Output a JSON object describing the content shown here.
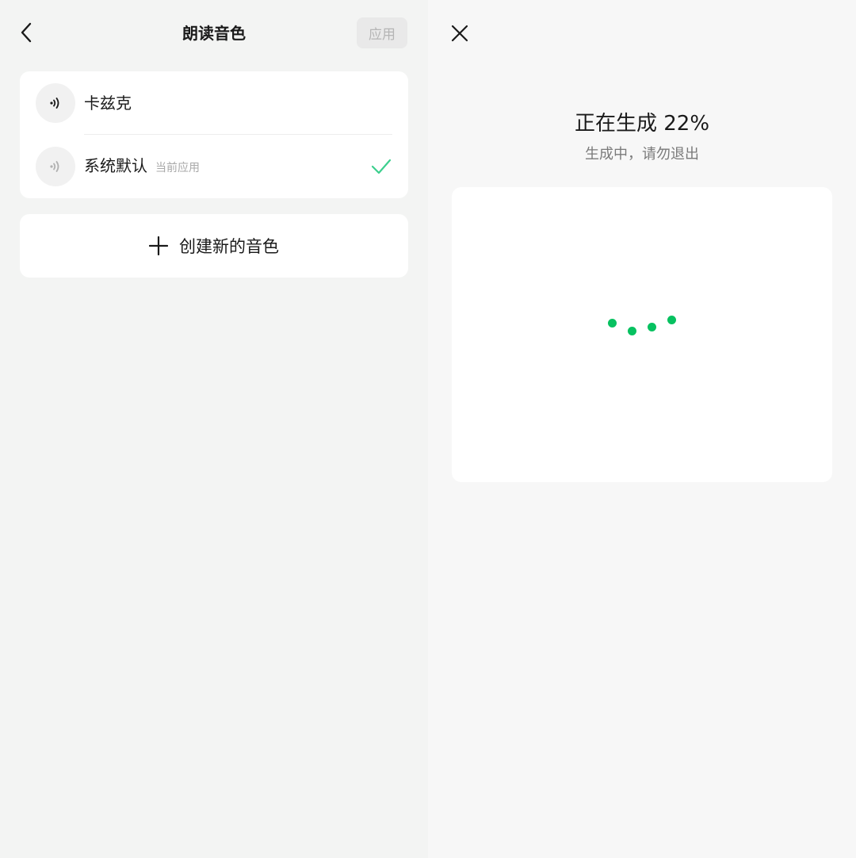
{
  "left": {
    "nav": {
      "back_icon": "chevron-left-icon",
      "title": "朗读音色",
      "apply_label": "应用"
    },
    "voices": [
      {
        "name": "卡兹克",
        "icon": "sound-wave-icon",
        "tag": "",
        "selected": false
      },
      {
        "name": "系统默认",
        "icon": "sound-wave-icon",
        "tag": "当前应用",
        "selected": true
      }
    ],
    "create": {
      "icon": "plus-icon",
      "label": "创建新的音色"
    }
  },
  "right": {
    "close_icon": "close-icon",
    "title": "正在生成 22%",
    "progress_percent": 22,
    "subtitle": "生成中，请勿退出",
    "loader": {
      "icon": "loading-dots-icon",
      "dot_count": 4,
      "color": "#07c160"
    }
  },
  "colors": {
    "accent": "#07c160",
    "check": "#3ccf8e",
    "background": "#f3f4f3",
    "card": "#ffffff",
    "disabled_text": "#b5b5b5"
  }
}
